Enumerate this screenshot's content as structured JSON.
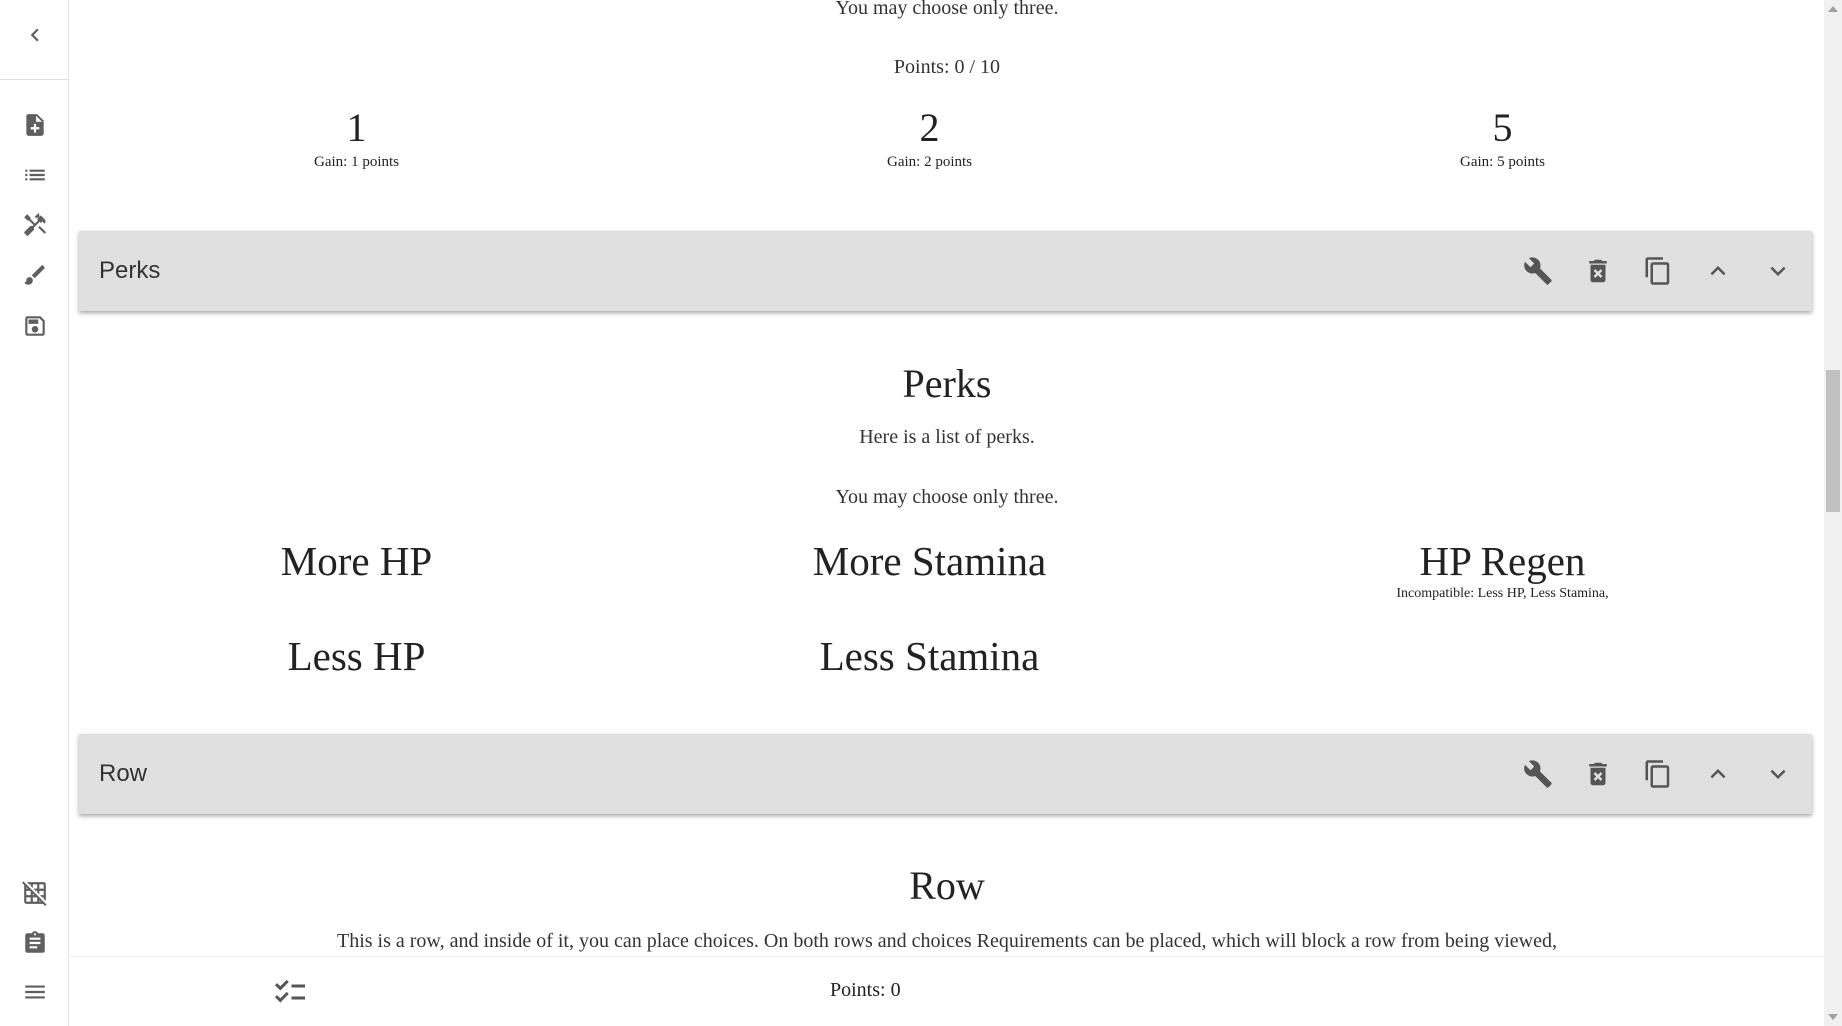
{
  "sidebar": {
    "back_icon": "chevron-left-icon",
    "items": [
      {
        "icon": "note-add-icon"
      },
      {
        "icon": "list-icon"
      },
      {
        "icon": "tools-icon"
      },
      {
        "icon": "brush-icon"
      },
      {
        "icon": "save-icon"
      }
    ],
    "bottom_items": [
      {
        "icon": "grid-off-icon"
      },
      {
        "icon": "clipboard-icon"
      },
      {
        "icon": "menu-icon"
      }
    ]
  },
  "top_section": {
    "instruction": "You may choose only three.",
    "points": "Points: 0 / 10",
    "choices": [
      {
        "title": "1",
        "gain": "Gain: 1 points"
      },
      {
        "title": "2",
        "gain": "Gain: 2 points"
      },
      {
        "title": "5",
        "gain": "Gain: 5 points"
      }
    ]
  },
  "perks_bar": {
    "title": "Perks",
    "buttons": [
      "wrench-icon",
      "delete-icon",
      "copy-icon",
      "chevron-up-icon",
      "chevron-down-icon"
    ]
  },
  "perks_section": {
    "heading": "Perks",
    "description": "Here is a list of perks.",
    "instruction": "You may choose only three.",
    "choices": [
      {
        "title": "More HP",
        "note": ""
      },
      {
        "title": "More Stamina",
        "note": ""
      },
      {
        "title": "HP Regen",
        "note": "Incompatible: Less HP, Less Stamina,"
      },
      {
        "title": "Less HP",
        "note": ""
      },
      {
        "title": "Less Stamina",
        "note": ""
      }
    ]
  },
  "row_bar": {
    "title": "Row"
  },
  "row_section": {
    "heading": "Row",
    "description": "This is a row, and inside of it, you can place choices. On both rows and choices Requirements can be placed, which will block a row from being viewed,"
  },
  "bottom_bar": {
    "points": "Points: 0",
    "checklist_icon": "checklist-icon"
  }
}
